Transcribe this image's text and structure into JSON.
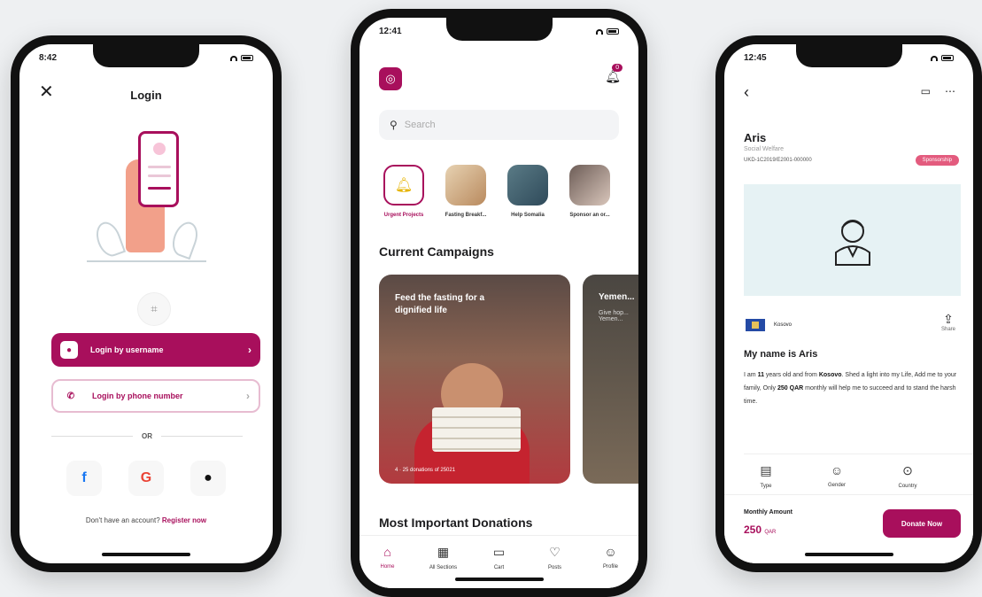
{
  "phone1": {
    "time": "8:42",
    "title": "Login",
    "login_username": "Login by username",
    "login_phone": "Login by phone number",
    "or": "OR",
    "no_account": "Don't have an account?",
    "register": "Register now"
  },
  "phone2": {
    "time": "12:41",
    "search_placeholder": "Search",
    "notification_count": "0",
    "stories": [
      {
        "label": "Urgent Projects"
      },
      {
        "label": "Fasting Breakf..."
      },
      {
        "label": "Help Somalia"
      },
      {
        "label": "Sponsor an or..."
      }
    ],
    "current_campaigns": "Current Campaigns",
    "campaigns": [
      {
        "title": "Feed the fasting for a dignified life",
        "footer": "4 · 25 donations of 25021"
      },
      {
        "title": "Yemen...",
        "subtitle": "Give hop... Yemen..."
      }
    ],
    "most_important": "Most Important Donations",
    "tabs": [
      {
        "label": "Home"
      },
      {
        "label": "All Sections"
      },
      {
        "label": "Cart"
      },
      {
        "label": "Posts"
      },
      {
        "label": "Profile"
      }
    ]
  },
  "phone3": {
    "time": "12:45",
    "name": "Aris",
    "sub": "Social Welfare",
    "id": "UKD-1C2019/E2001-000000",
    "pill": "Sponsorship",
    "country": "Kosovo",
    "share": "Share",
    "heading": "My name is Aris",
    "desc_1": "I am ",
    "desc_age": "11",
    "desc_2": " years old and from ",
    "desc_country": "Kosovo",
    "desc_3": ". Shed a light into my Life, Add me to your family, Only ",
    "desc_amount": "250 QAR",
    "desc_4": " monthly will help me to succeed and to stand the harsh time.",
    "info": [
      {
        "label": "Type"
      },
      {
        "label": "Gender"
      },
      {
        "label": "Country"
      }
    ],
    "monthly_amount_label": "Monthly Amount",
    "monthly_amount": "250",
    "currency": "QAR",
    "donate": "Donate Now"
  },
  "colors": {
    "accent": "#a80f5c",
    "pill": "#e35b7e",
    "bg": "#eef0f2"
  }
}
